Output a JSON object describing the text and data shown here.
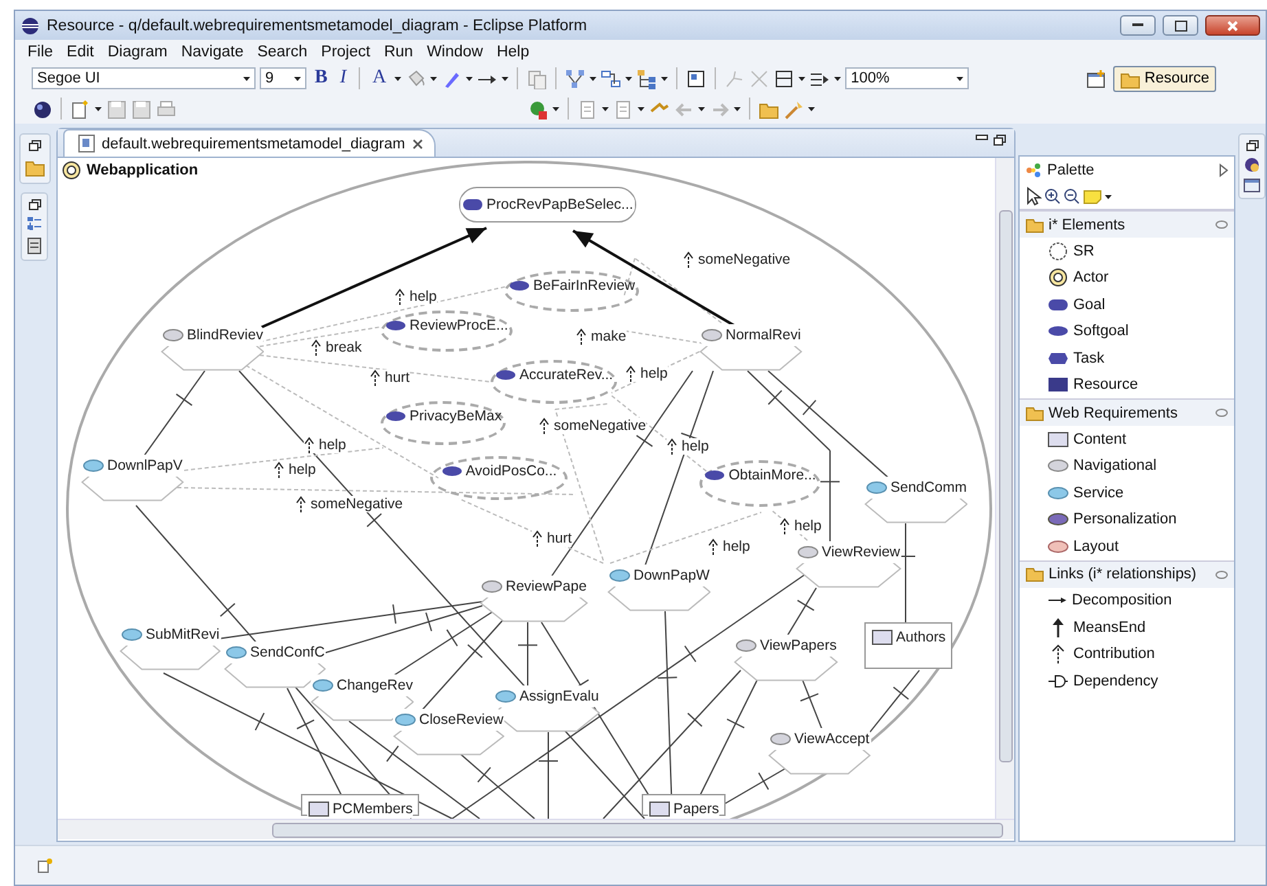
{
  "window": {
    "title": "Resource - q/default.webrequirementsmetamodel_diagram - Eclipse Platform"
  },
  "menu": [
    "File",
    "Edit",
    "Diagram",
    "Navigate",
    "Search",
    "Project",
    "Run",
    "Window",
    "Help"
  ],
  "toolbar": {
    "font_name": "Segoe UI",
    "font_size": "9",
    "format_buttons": [
      "B",
      "I",
      "A"
    ],
    "zoom": "100%",
    "perspective": "Resource"
  },
  "editor_tab": {
    "title": "default.webrequirementsmetamodel_diagram"
  },
  "diagram": {
    "actor": "Webapplication",
    "nodes": [
      {
        "label": "ProcRevPapBeSelec...",
        "kind": "goal"
      },
      {
        "label": "BeFairInReview",
        "kind": "softgoal"
      },
      {
        "label": "ReviewProcE...",
        "kind": "softgoal"
      },
      {
        "label": "AccurateRev...",
        "kind": "softgoal"
      },
      {
        "label": "PrivacyBeMax",
        "kind": "softgoal"
      },
      {
        "label": "AvoidPosCo...",
        "kind": "softgoal"
      },
      {
        "label": "ObtainMore...",
        "kind": "softgoal"
      },
      {
        "label": "BlindReviev",
        "kind": "navigational"
      },
      {
        "label": "NormalRevi",
        "kind": "navigational"
      },
      {
        "label": "DownlPapV",
        "kind": "service"
      },
      {
        "label": "SendComm",
        "kind": "service"
      },
      {
        "label": "ViewReview",
        "kind": "navigational"
      },
      {
        "label": "ReviewPape",
        "kind": "navigational"
      },
      {
        "label": "DownPapW",
        "kind": "service"
      },
      {
        "label": "SubMitRevi",
        "kind": "service"
      },
      {
        "label": "SendConfC",
        "kind": "service"
      },
      {
        "label": "ChangeRev",
        "kind": "service"
      },
      {
        "label": "CloseReview",
        "kind": "service"
      },
      {
        "label": "AssignEvalu",
        "kind": "service"
      },
      {
        "label": "ViewPapers",
        "kind": "navigational"
      },
      {
        "label": "ViewAccept",
        "kind": "navigational"
      },
      {
        "label": "Authors",
        "kind": "content"
      },
      {
        "label": "PCMembers",
        "kind": "content"
      },
      {
        "label": "Papers",
        "kind": "content"
      }
    ],
    "contributions": [
      "help",
      "break",
      "hurt",
      "make",
      "help",
      "someNegative",
      "someNegative",
      "help",
      "help",
      "someNegative",
      "help",
      "hurt",
      "help",
      "help"
    ]
  },
  "palette": {
    "title": "Palette",
    "drawers": [
      {
        "title": "i* Elements",
        "items": [
          {
            "label": "SR",
            "kind": "sr"
          },
          {
            "label": "Actor",
            "kind": "actor"
          },
          {
            "label": "Goal",
            "kind": "goal"
          },
          {
            "label": "Softgoal",
            "kind": "softgoal"
          },
          {
            "label": "Task",
            "kind": "task"
          },
          {
            "label": "Resource",
            "kind": "resource"
          }
        ]
      },
      {
        "title": "Web Requirements",
        "items": [
          {
            "label": "Content",
            "kind": "content"
          },
          {
            "label": "Navigational",
            "kind": "navigational"
          },
          {
            "label": "Service",
            "kind": "service"
          },
          {
            "label": "Personalization",
            "kind": "personalization"
          },
          {
            "label": "Layout",
            "kind": "layout"
          }
        ]
      },
      {
        "title": "Links (i* relationships)",
        "items": [
          {
            "label": "Decomposition",
            "kind": "decomposition"
          },
          {
            "label": "MeansEnd",
            "kind": "meansend"
          },
          {
            "label": "Contribution",
            "kind": "contribution"
          },
          {
            "label": "Dependency",
            "kind": "dependency"
          }
        ]
      }
    ]
  }
}
